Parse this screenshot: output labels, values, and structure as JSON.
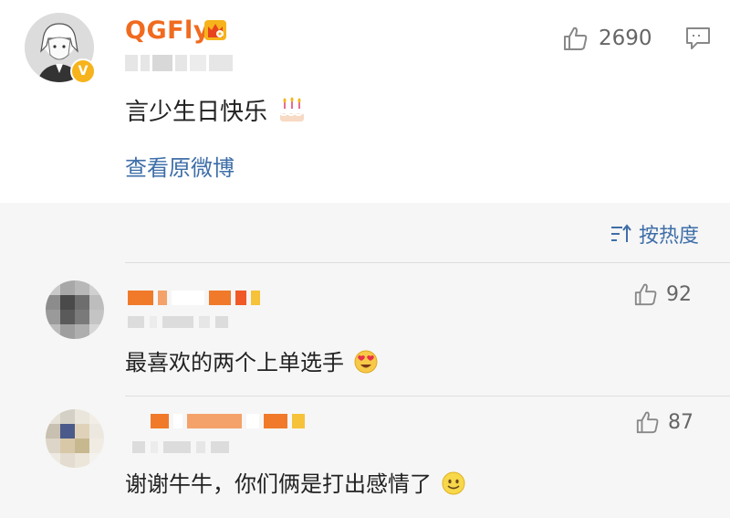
{
  "post": {
    "author": "QGFly",
    "text": "言少生日快乐",
    "view_original": "查看原微博",
    "likes": "2690",
    "icons": {
      "verified": "verified-v-badge",
      "vip": "crown-icon",
      "emoji": "birthday-cake-emoji",
      "like": "thumbs-up-icon",
      "comment": "comment-bubble-icon"
    },
    "verified_label": "V"
  },
  "sort": {
    "label": "按热度",
    "icon": "sort-icon"
  },
  "comments": [
    {
      "text": "最喜欢的两个上单选手",
      "emoji": "heart-eyes-emoji",
      "likes": "92"
    },
    {
      "text": "谢谢牛牛，你们俩是打出感情了",
      "emoji": "smiley-emoji",
      "likes": "87"
    }
  ],
  "colors": {
    "author": "#f06b1f",
    "link": "#3e6ea8",
    "badge": "#f6b31b"
  }
}
